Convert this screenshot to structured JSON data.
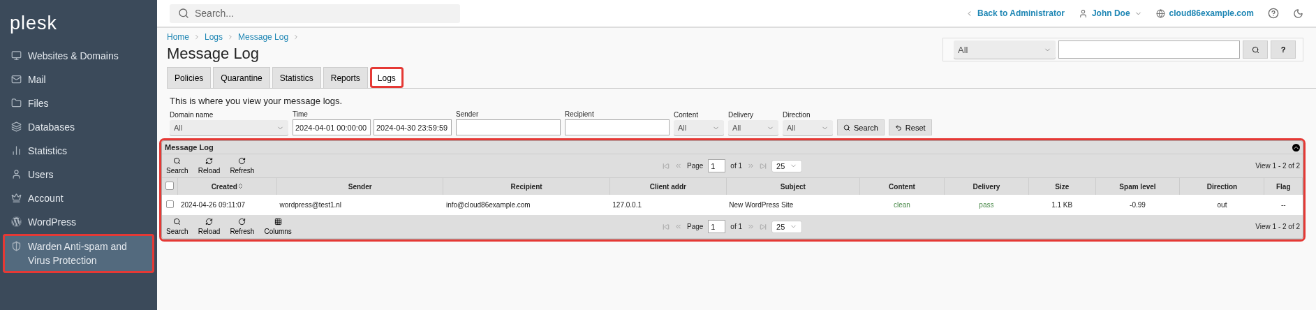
{
  "sidebar": {
    "logo": "plesk",
    "items": [
      {
        "label": "Websites & Domains",
        "selected": false,
        "highlighted": false
      },
      {
        "label": "Mail",
        "selected": false,
        "highlighted": false
      },
      {
        "label": "Files",
        "selected": false,
        "highlighted": false
      },
      {
        "label": "Databases",
        "selected": false,
        "highlighted": false
      },
      {
        "label": "Statistics",
        "selected": false,
        "highlighted": false
      },
      {
        "label": "Users",
        "selected": false,
        "highlighted": false
      },
      {
        "label": "Account",
        "selected": false,
        "highlighted": false
      },
      {
        "label": "WordPress",
        "selected": false,
        "highlighted": false
      },
      {
        "label": "Warden Anti-spam and Virus Protection",
        "selected": true,
        "highlighted": true
      }
    ]
  },
  "topbar": {
    "search_placeholder": "Search...",
    "back_link": "Back to Administrator",
    "user": "John Doe",
    "domain": "cloud86example.com"
  },
  "breadcrumb": [
    "Home",
    "Logs",
    "Message Log"
  ],
  "title": "Message Log",
  "quick_search": {
    "scope": "All",
    "help": "?"
  },
  "tabs": [
    {
      "label": "Policies",
      "selected": false,
      "highlighted": false
    },
    {
      "label": "Quarantine",
      "selected": false,
      "highlighted": false
    },
    {
      "label": "Statistics",
      "selected": false,
      "highlighted": false
    },
    {
      "label": "Reports",
      "selected": false,
      "highlighted": false
    },
    {
      "label": "Logs",
      "selected": true,
      "highlighted": true
    }
  ],
  "description": "This is where you view your message logs.",
  "filters": [
    {
      "kind": "select",
      "label": "Domain name",
      "value": "All"
    },
    {
      "kind": "range",
      "label": "Time",
      "from": "2024-04-01 00:00:00",
      "to": "2024-04-30 23:59:59"
    },
    {
      "kind": "input",
      "label": "Sender"
    },
    {
      "kind": "input",
      "label": "Recipient"
    },
    {
      "kind": "select",
      "label": "Content",
      "value": "All"
    },
    {
      "kind": "select",
      "label": "Delivery",
      "value": "All"
    },
    {
      "kind": "select",
      "label": "Direction",
      "value": "All"
    }
  ],
  "filter_buttons": [
    "Search",
    "Reset"
  ],
  "panel": {
    "title": "Message Log",
    "highlighted": true,
    "top_bar": {
      "tools": [
        "Search",
        "Reload",
        "Refresh"
      ],
      "page_label": "Page",
      "page": "1",
      "of": "of 1",
      "per_page": "25",
      "view": "View 1 - 2 of 2"
    },
    "header_checked": false,
    "columns": [
      {
        "label": "Created",
        "sorted": true
      },
      {
        "label": "Sender",
        "sorted": false
      },
      {
        "label": "Recipient",
        "sorted": false
      },
      {
        "label": "Client addr",
        "sorted": false
      },
      {
        "label": "Subject",
        "sorted": false
      },
      {
        "label": "Content",
        "sorted": false
      },
      {
        "label": "Delivery",
        "sorted": false
      },
      {
        "label": "Size",
        "sorted": false
      },
      {
        "label": "Spam level",
        "sorted": false
      },
      {
        "label": "Direction",
        "sorted": false
      },
      {
        "label": "Flag",
        "sorted": false
      }
    ],
    "rows": [
      {
        "checked": false,
        "cells": [
          {
            "text": "2024-04-26 09:11:07",
            "kind": "text"
          },
          {
            "text": "wordpress@test1.nl",
            "kind": "text"
          },
          {
            "text": "info@cloud86example.com",
            "kind": "text"
          },
          {
            "text": "127.0.0.1",
            "kind": "text"
          },
          {
            "text": "New WordPress Site",
            "kind": "text"
          },
          {
            "text": "clean",
            "kind": "status"
          },
          {
            "text": "pass",
            "kind": "status"
          },
          {
            "text": "1.1 KB",
            "kind": "text"
          },
          {
            "text": "-0.99",
            "kind": "text"
          },
          {
            "text": "out",
            "kind": "text"
          },
          {
            "text": "--",
            "kind": "text"
          }
        ]
      }
    ],
    "bottom_bar": {
      "tools": [
        "Search",
        "Reload",
        "Refresh",
        "Columns"
      ],
      "page_label": "Page",
      "page": "1",
      "of": "of 1",
      "per_page": "25",
      "view": "View 1 - 2 of 2"
    }
  }
}
